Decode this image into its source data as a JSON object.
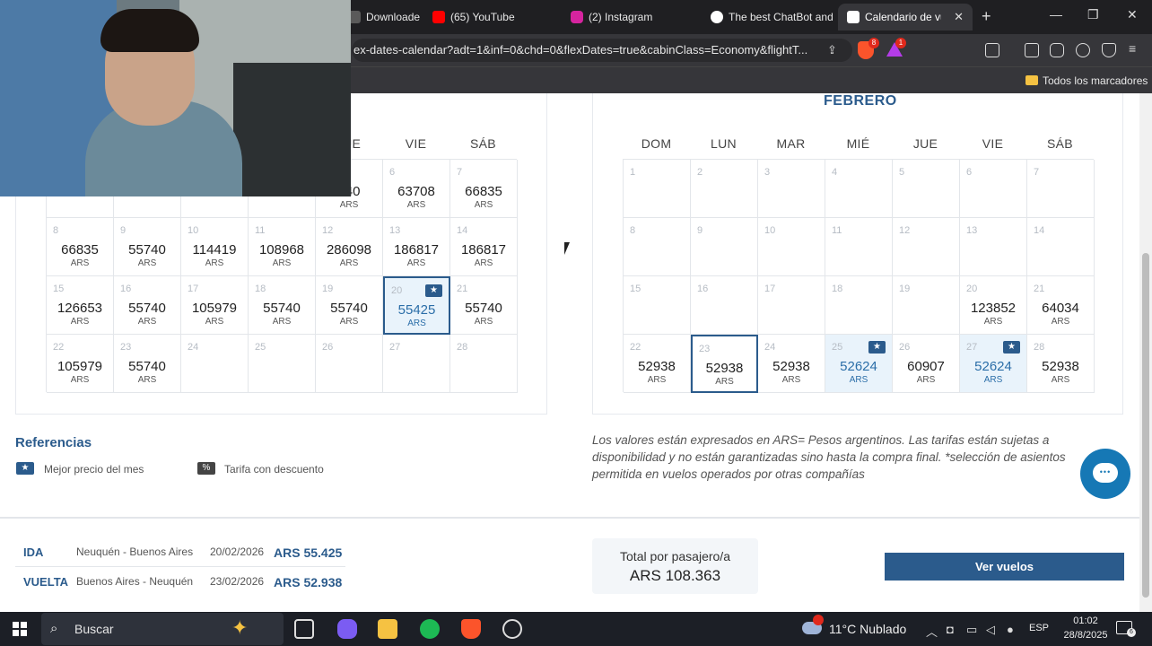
{
  "browser": {
    "tabs": [
      {
        "label": "Downloade",
        "color": "#5a5a5a"
      },
      {
        "label": "(65) YouTube",
        "color": "#ff0000"
      },
      {
        "label": "(2) Instagram",
        "color": "#d6249f"
      },
      {
        "label": "The best ChatBot and",
        "color": "#ffffff"
      },
      {
        "label": "Calendario de vu",
        "color": "#ffffff"
      }
    ],
    "new_tab": "+",
    "url": "ex-dates-calendar?adt=1&inf=0&chd=0&flexDates=true&cabinClass=Economy&flightT...",
    "brave_badge": "8",
    "rewards_badge": "1",
    "bookmarks_label": "Todos los marcadores"
  },
  "calendar": {
    "currency": "ARS",
    "left_weekdays": [
      "JUE",
      "VIE",
      "SÁB"
    ],
    "left_weeks": [
      [
        null,
        null,
        null,
        null,
        {
          "day": "",
          "price": "740"
        },
        {
          "day": "6",
          "price": "63708"
        },
        {
          "day": "7",
          "price": "66835"
        }
      ],
      [
        {
          "day": "8",
          "price": "66835"
        },
        {
          "day": "9",
          "price": "55740"
        },
        {
          "day": "10",
          "price": "114419"
        },
        {
          "day": "11",
          "price": "108968"
        },
        {
          "day": "12",
          "price": "286098"
        },
        {
          "day": "13",
          "price": "186817"
        },
        {
          "day": "14",
          "price": "186817"
        }
      ],
      [
        {
          "day": "15",
          "price": "126653"
        },
        {
          "day": "16",
          "price": "55740"
        },
        {
          "day": "17",
          "price": "105979"
        },
        {
          "day": "18",
          "price": "55740"
        },
        {
          "day": "19",
          "price": "55740"
        },
        {
          "day": "20",
          "price": "55425",
          "best": true,
          "selected": true
        },
        {
          "day": "21",
          "price": "55740"
        }
      ],
      [
        {
          "day": "22",
          "price": "105979"
        },
        {
          "day": "23",
          "price": "55740"
        },
        {
          "day": "24"
        },
        {
          "day": "25"
        },
        {
          "day": "26"
        },
        {
          "day": "27"
        },
        {
          "day": "28"
        }
      ]
    ],
    "right_month": "FEBRERO",
    "right_weekdays": [
      "DOM",
      "LUN",
      "MAR",
      "MIÉ",
      "JUE",
      "VIE",
      "SÁB"
    ],
    "right_weeks": [
      [
        {
          "day": "1"
        },
        {
          "day": "2"
        },
        {
          "day": "3"
        },
        {
          "day": "4"
        },
        {
          "day": "5"
        },
        {
          "day": "6"
        },
        {
          "day": "7"
        }
      ],
      [
        {
          "day": "8"
        },
        {
          "day": "9"
        },
        {
          "day": "10"
        },
        {
          "day": "11"
        },
        {
          "day": "12"
        },
        {
          "day": "13"
        },
        {
          "day": "14"
        }
      ],
      [
        {
          "day": "15"
        },
        {
          "day": "16"
        },
        {
          "day": "17"
        },
        {
          "day": "18"
        },
        {
          "day": "19"
        },
        {
          "day": "20",
          "price": "123852"
        },
        {
          "day": "21",
          "price": "64034"
        }
      ],
      [
        {
          "day": "22",
          "price": "52938"
        },
        {
          "day": "23",
          "price": "52938",
          "selected": true
        },
        {
          "day": "24",
          "price": "52938"
        },
        {
          "day": "25",
          "price": "52624",
          "best": true
        },
        {
          "day": "26",
          "price": "60907"
        },
        {
          "day": "27",
          "price": "52624",
          "best": true
        },
        {
          "day": "28",
          "price": "52938"
        }
      ]
    ]
  },
  "references": {
    "title": "Referencias",
    "best_label": "Mejor precio del mes",
    "discount_label": "Tarifa con descuento"
  },
  "disclaimer": "Los valores están expresados en ARS= Pesos argentinos. Las tarifas están sujetas a disponibilidad y no están garantizadas sino hasta la compra final. *selección de asientos permitida en vuelos operados por otras compañías",
  "summary": {
    "legs": [
      {
        "type": "IDA",
        "route": "Neuquén - Buenos Aires",
        "date": "20/02/2026",
        "price": "ARS 55.425"
      },
      {
        "type": "VUELTA",
        "route": "Buenos Aires - Neuquén",
        "date": "23/02/2026",
        "price": "ARS 52.938"
      }
    ],
    "total_label": "Total por pasajero/a",
    "total_value": "ARS 108.363",
    "cta": "Ver vuelos"
  },
  "taskbar": {
    "search_label": "Buscar",
    "weather": "11°C  Nublado",
    "language": "ESP",
    "time": "01:02",
    "date": "28/8/2025",
    "notif_count": "6"
  },
  "colors": {
    "primary": "#2b5b8c",
    "best_bg": "#e9f3fb",
    "chat": "#1678b5"
  }
}
